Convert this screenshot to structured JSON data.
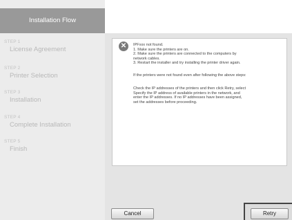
{
  "sidebar": {
    "title": "Installation Flow",
    "steps": [
      {
        "num": "STEP 1",
        "label": "License Agreement"
      },
      {
        "num": "STEP 2",
        "label": "Printer Selection"
      },
      {
        "num": "STEP 3",
        "label": "Installation"
      },
      {
        "num": "STEP 4",
        "label": "Complete Installation"
      },
      {
        "num": "STEP 5",
        "label": "Finish"
      }
    ]
  },
  "message": {
    "icon": "close-icon",
    "lines": [
      "IPFxxx not found.",
      "1. Make sure the printers are on.",
      "2. Make sure the printers are connected to the computers by",
      "network cables.",
      "3. Restart the installer and try installing the printer driver again."
    ],
    "note": "If the printers were not found even after following the above steps:",
    "instructions": [
      "Check the IP addresses of the printers and then click Retry, select",
      "Specify the IP address of available printers in the network, and",
      "enter the IP addresses. If no IP addresses have been assigned,",
      "set the addresses before proceeding."
    ]
  },
  "buttons": {
    "cancel": "Cancel",
    "retry": "Retry"
  }
}
